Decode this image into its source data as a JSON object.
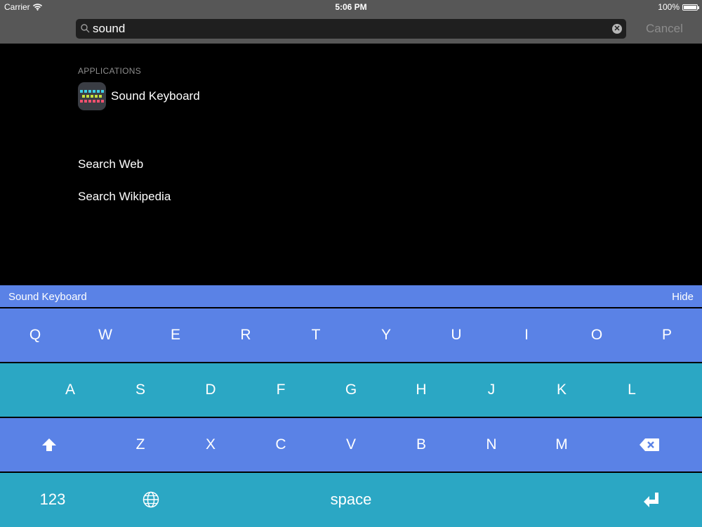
{
  "status_bar": {
    "carrier": "Carrier",
    "time": "5:06 PM",
    "battery": "100%"
  },
  "search": {
    "query": "sound",
    "placeholder": "",
    "cancel_label": "Cancel"
  },
  "results": {
    "section_header": "APPLICATIONS",
    "app": {
      "name": "Sound Keyboard",
      "icon": "keyboard-app-icon"
    },
    "web_items": [
      "Search Web",
      "Search Wikipedia"
    ]
  },
  "keyboard": {
    "bar_title": "Sound Keyboard",
    "hide_label": "Hide",
    "row1": [
      "Q",
      "W",
      "E",
      "R",
      "T",
      "Y",
      "U",
      "I",
      "O",
      "P"
    ],
    "row2": [
      "A",
      "S",
      "D",
      "F",
      "G",
      "H",
      "J",
      "K",
      "L"
    ],
    "row3": [
      "Z",
      "X",
      "C",
      "V",
      "B",
      "N",
      "M"
    ],
    "numbers_label": "123",
    "space_label": "space"
  },
  "colors": {
    "keyboard_blue": "#5a82e6",
    "keyboard_teal": "#2ba7c4",
    "status_bar": "#575757"
  }
}
